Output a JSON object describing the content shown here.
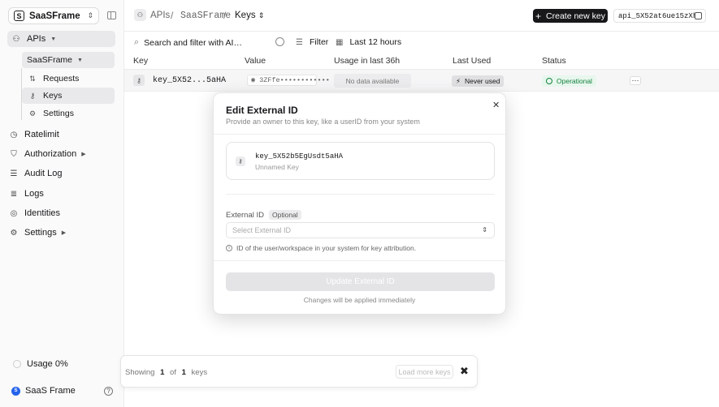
{
  "sidebar": {
    "workspace": {
      "logo": "S",
      "name": "SaaSFrame"
    },
    "apis_label": "APIs",
    "api_name": "SaaSFrame",
    "sub_items": [
      {
        "label": "Requests"
      },
      {
        "label": "Keys"
      },
      {
        "label": "Settings"
      }
    ],
    "nav_items": [
      {
        "label": "Ratelimit"
      },
      {
        "label": "Authorization"
      },
      {
        "label": "Audit Log"
      },
      {
        "label": "Logs"
      },
      {
        "label": "Identities"
      },
      {
        "label": "Settings"
      }
    ],
    "usage_label": "Usage 0%",
    "user": {
      "initial": "S",
      "name": "SaaS Frame"
    }
  },
  "header": {
    "breadcrumb": [
      "APIs",
      "SaaSFrame",
      "Keys"
    ],
    "create_button": "Create new key",
    "api_id": "api_5X52at6ue15zXh…"
  },
  "filters": {
    "search_placeholder": "Search and filter with AI…",
    "filter_label": "Filter",
    "time_label": "Last 12 hours"
  },
  "table": {
    "columns": [
      "Key",
      "Value",
      "Usage in last 36h",
      "Last Used",
      "Status"
    ],
    "rows": [
      {
        "key": "key_5X52...5aHA",
        "value": "3ZFfe••••••••••••",
        "usage": "No data available",
        "last_used": "Never used",
        "status": "Operational"
      }
    ]
  },
  "pager": {
    "showing": "Showing",
    "count": "1",
    "of": "of",
    "total": "1",
    "unit": "keys",
    "load_more": "Load more keys"
  },
  "modal": {
    "title": "Edit External ID",
    "subtitle": "Provide an owner to this key, like a userID from your system",
    "key_id": "key_5X52b5EgUsdt5aHA",
    "key_name": "Unnamed Key",
    "field_label": "External ID",
    "optional_label": "Optional",
    "select_placeholder": "Select External ID",
    "help_text": "ID of the user/workspace in your system for key attribution.",
    "submit_label": "Update External ID",
    "note": "Changes will be applied immediately"
  },
  "colors": {
    "primary": "#18181b",
    "success": "#15803d",
    "success_bg": "#e8f7ee",
    "avatar": "#2563eb"
  }
}
